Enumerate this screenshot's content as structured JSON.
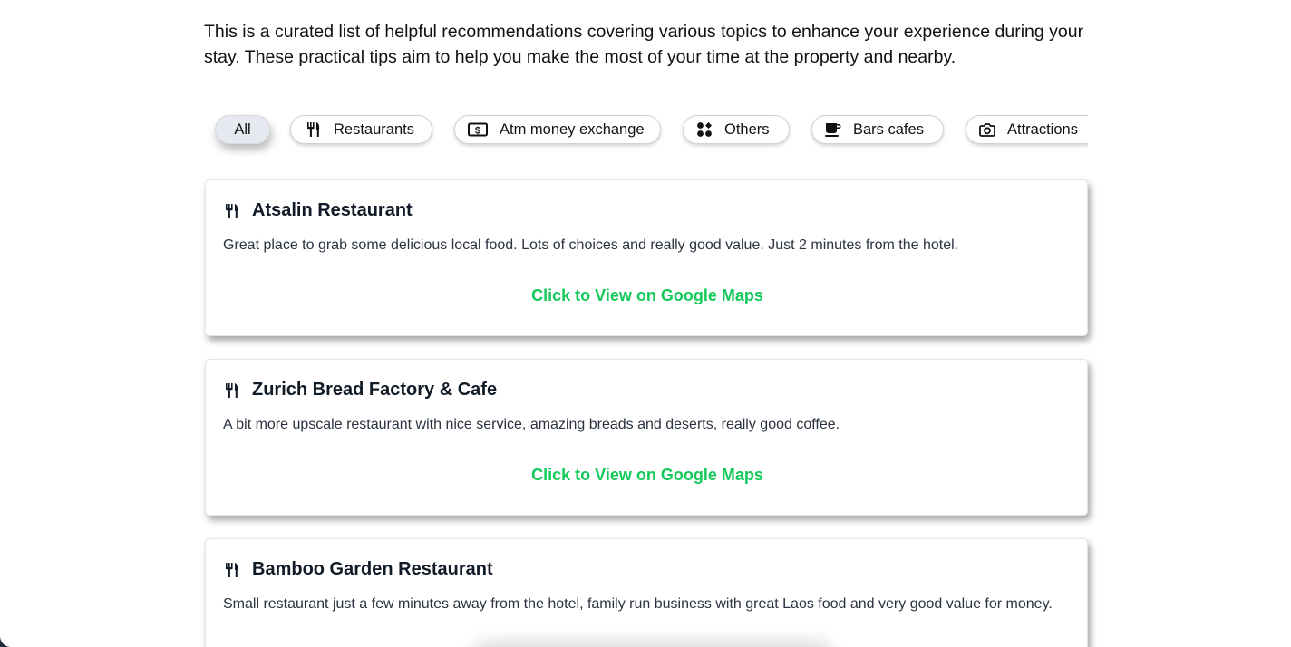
{
  "intro": {
    "text": "This is a curated list of helpful recommendations covering various topics to enhance your experience during your stay. These practical tips aim to help you make the most of your time at the property and nearby."
  },
  "filters": [
    {
      "label": "All",
      "icon": "",
      "active": true
    },
    {
      "label": "Restaurants",
      "icon": "fork-knife-icon",
      "active": false
    },
    {
      "label": "Atm money exchange",
      "icon": "money-bill-icon",
      "active": false
    },
    {
      "label": "Others",
      "icon": "grid-dots-icon",
      "active": false
    },
    {
      "label": "Bars cafes",
      "icon": "coffee-cup-icon",
      "active": false
    },
    {
      "label": "Attractions",
      "icon": "camera-icon",
      "active": false
    }
  ],
  "cards": [
    {
      "title": "Atsalin Restaurant",
      "icon": "fork-knife-icon",
      "description": "Great place to grab some delicious local food. Lots of choices and really good value. Just 2 minutes from the hotel.",
      "link": "Click to View on Google Maps"
    },
    {
      "title": "Zurich Bread Factory & Cafe",
      "icon": "fork-knife-icon",
      "description": "A bit more upscale restaurant with nice service, amazing breads and deserts, really good coffee.",
      "link": "Click to View on Google Maps"
    },
    {
      "title": "Bamboo Garden Restaurant",
      "icon": "fork-knife-icon",
      "description": "Small restaurant just a few minutes away from the hotel, family run business with great Laos food and very good value for money.",
      "link": ""
    }
  ],
  "colors": {
    "link": "#13c95a",
    "frame": "#1f2a3c",
    "active_chip": "#e6e9ef"
  }
}
